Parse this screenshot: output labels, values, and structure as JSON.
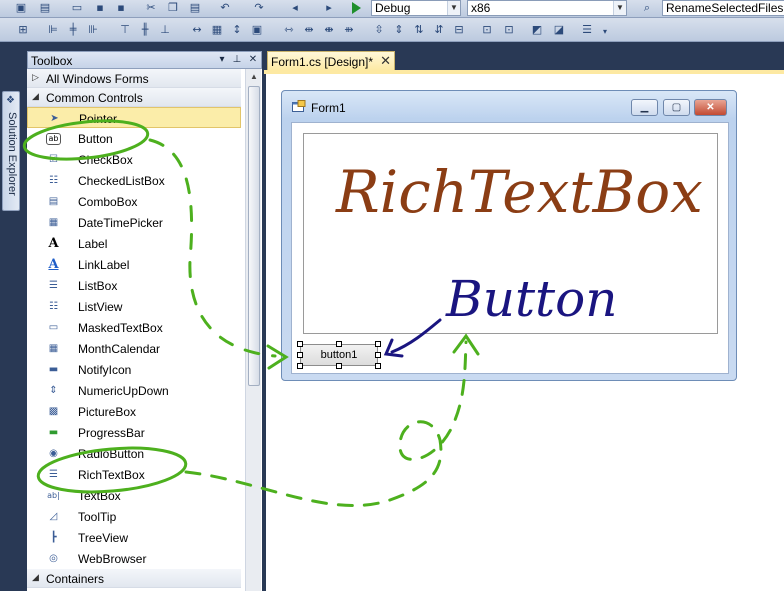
{
  "toolbar": {
    "config_combo": "Debug",
    "platform_combo": "x86",
    "project_combo": "RenameSelectedFiles"
  },
  "side_tab": {
    "label": "Solution Explorer",
    "icon": "solution-explorer-icon"
  },
  "toolbox": {
    "title": "Toolbox",
    "pin_icon": "pin-icon",
    "close_icon": "close-icon",
    "dropdown_icon": "chevron-down-icon",
    "categories": [
      {
        "label": "All Windows Forms",
        "expanded": false
      },
      {
        "label": "Common Controls",
        "expanded": true
      },
      {
        "label": "Containers",
        "expanded": true
      }
    ],
    "items": [
      {
        "label": "Pointer",
        "icon": "pointer-icon",
        "selected": true
      },
      {
        "label": "Button",
        "icon": "button-icon"
      },
      {
        "label": "CheckBox",
        "icon": "checkbox-icon"
      },
      {
        "label": "CheckedListBox",
        "icon": "checkedlistbox-icon"
      },
      {
        "label": "ComboBox",
        "icon": "combobox-icon"
      },
      {
        "label": "DateTimePicker",
        "icon": "datetimepicker-icon"
      },
      {
        "label": "Label",
        "icon": "label-icon"
      },
      {
        "label": "LinkLabel",
        "icon": "linklabel-icon"
      },
      {
        "label": "ListBox",
        "icon": "listbox-icon"
      },
      {
        "label": "ListView",
        "icon": "listview-icon"
      },
      {
        "label": "MaskedTextBox",
        "icon": "maskedtextbox-icon"
      },
      {
        "label": "MonthCalendar",
        "icon": "monthcalendar-icon"
      },
      {
        "label": "NotifyIcon",
        "icon": "notifyicon-icon"
      },
      {
        "label": "NumericUpDown",
        "icon": "numericupdown-icon"
      },
      {
        "label": "PictureBox",
        "icon": "picturebox-icon"
      },
      {
        "label": "ProgressBar",
        "icon": "progressbar-icon"
      },
      {
        "label": "RadioButton",
        "icon": "radiobutton-icon"
      },
      {
        "label": "RichTextBox",
        "icon": "richtextbox-icon"
      },
      {
        "label": "TextBox",
        "icon": "textbox-icon"
      },
      {
        "label": "ToolTip",
        "icon": "tooltip-icon"
      },
      {
        "label": "TreeView",
        "icon": "treeview-icon"
      },
      {
        "label": "WebBrowser",
        "icon": "webbrowser-icon"
      }
    ]
  },
  "document": {
    "tab_label": "Form1.cs [Design]*",
    "form_title": "Form1",
    "button_text": "button1"
  },
  "annotations": {
    "richtextbox_note": "RichTextBox",
    "button_note": "Button",
    "highlight_color": "#4db01e",
    "rtb_note_color": "#8b3d14",
    "button_note_color": "#1a1580"
  }
}
